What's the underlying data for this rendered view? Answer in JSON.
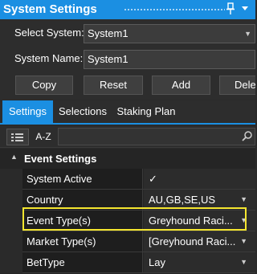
{
  "window": {
    "title": "System Settings",
    "pin_icon": "pin-icon",
    "dropdown_icon": "chevron-down-icon"
  },
  "selection": {
    "select_system_label": "Select System:",
    "select_system_value": "System1",
    "system_name_label": "System Name:",
    "system_name_value": "System1"
  },
  "actions": {
    "copy_label": "Copy",
    "reset_label": "Reset",
    "add_label": "Add",
    "delete_label": "Dele"
  },
  "tabs": [
    {
      "label": "Settings",
      "active": true
    },
    {
      "label": "Selections",
      "active": false
    },
    {
      "label": "Staking Plan",
      "active": false
    }
  ],
  "toolbar": {
    "categorized_icon": "categorized-list-icon",
    "az_label": "A-Z",
    "search_icon": "search-icon"
  },
  "grid": {
    "category": "Event Settings",
    "rows": [
      {
        "name": "System Active",
        "value": "✓",
        "type": "checkbox"
      },
      {
        "name": "Country",
        "value": "AU,GB,SE,US",
        "type": "dropdown"
      },
      {
        "name": "Event Type(s)",
        "value": "Greyhound Raci...",
        "type": "dropdown",
        "highlighted": true
      },
      {
        "name": "Market Type(s)",
        "value": "[Greyhound Raci...",
        "type": "dropdown"
      },
      {
        "name": "BetType",
        "value": "Lay",
        "type": "dropdown"
      }
    ]
  },
  "colors": {
    "accent": "#1b8fe2",
    "highlight": "#f5e62f",
    "background": "#2a2a2a"
  }
}
